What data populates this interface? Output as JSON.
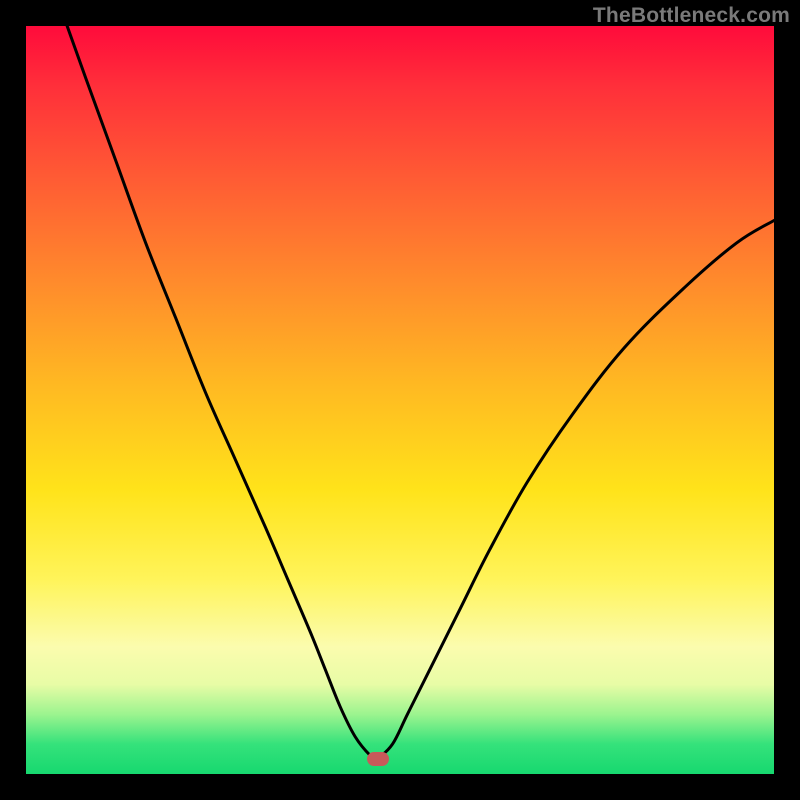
{
  "watermark": "TheBottleneck.com",
  "colors": {
    "frame": "#000000",
    "curve": "#000000",
    "marker": "#c85a5a",
    "gradient_stops": [
      "#ff0b3b",
      "#ff2f3a",
      "#ff5a34",
      "#ff8a2c",
      "#ffb922",
      "#ffe31a",
      "#fff45a",
      "#fbfcae",
      "#e8fca6",
      "#9cf48f",
      "#35e27b",
      "#17d86f"
    ]
  },
  "chart_data": {
    "type": "line",
    "title": "",
    "xlabel": "",
    "ylabel": "",
    "xlim": [
      0,
      100
    ],
    "ylim": [
      0,
      100
    ],
    "grid": false,
    "legend": false,
    "note": "x/y are percentages of the plot area; y=0 at bottom, y=100 at top. Left branch descends from top-left to a floor near x≈42–47, right branch rises toward the right edge exiting near y≈74.",
    "series": [
      {
        "name": "left-branch",
        "x": [
          5.5,
          8,
          12,
          16,
          20,
          24,
          28,
          32,
          35,
          38,
          40,
          42,
          44,
          46,
          47
        ],
        "values": [
          100,
          93,
          82,
          71,
          61,
          51,
          42,
          33,
          26,
          19,
          14,
          9,
          5,
          2.5,
          2
        ]
      },
      {
        "name": "right-branch",
        "x": [
          47,
          49,
          51,
          54,
          58,
          62,
          67,
          73,
          80,
          88,
          95,
          100
        ],
        "values": [
          2,
          4,
          8,
          14,
          22,
          30,
          39,
          48,
          57,
          65,
          71,
          74
        ]
      }
    ],
    "marker": {
      "x": 47,
      "y": 2
    }
  }
}
